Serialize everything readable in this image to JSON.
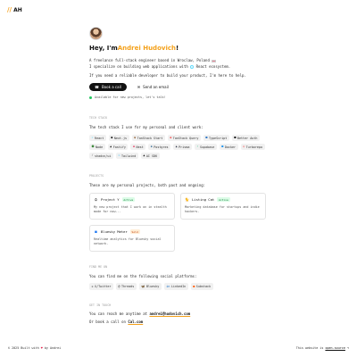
{
  "header": {
    "logo_slash": "//",
    "logo_text": "AH"
  },
  "hero": {
    "greeting_prefix": "Hey, I'm ",
    "name": "Andrei Hudovich",
    "greeting_suffix": "!",
    "line1": "A freelance full-stack engineer based in Wroclaw, Poland",
    "line2a": "I specialize on building web applications with",
    "line2b": "React",
    "line2c": "ecosystem.",
    "line3": "If you need a reliable developer to build your product, I'm here to help.",
    "book_call": "Book a call",
    "send_email": "Send an email",
    "availability": "Available for new projects, let's talk!"
  },
  "tech_stack": {
    "label": "TECH STACK",
    "text": "The tech stack I use for my personal and client work:",
    "tags": [
      {
        "icon": "react-icon",
        "glyph": "⚛",
        "color": "#61dafb",
        "label": "React"
      },
      {
        "icon": "nextjs-icon",
        "glyph": "●",
        "color": "#111111",
        "label": "Next.js"
      },
      {
        "icon": "tanstack-start-icon",
        "glyph": "◉",
        "color": "#8b5a2b",
        "label": "TanStack Start"
      },
      {
        "icon": "tanstack-query-icon",
        "glyph": "◉",
        "color": "#ef4444",
        "label": "TanStack Query"
      },
      {
        "icon": "typescript-icon",
        "glyph": "■",
        "color": "#3178c6",
        "label": "TypeScript"
      },
      {
        "icon": "better-auth-icon",
        "glyph": "■",
        "color": "#111111",
        "label": "Better Auth"
      },
      {
        "icon": "node-icon",
        "glyph": "⬢",
        "color": "#3c873a",
        "label": "Node"
      },
      {
        "icon": "fastify-icon",
        "glyph": "▲",
        "color": "#111111",
        "label": "Fastify"
      },
      {
        "icon": "nest-icon",
        "glyph": "◆",
        "color": "#e0234e",
        "label": "Nest"
      },
      {
        "icon": "postgres-icon",
        "glyph": "◆",
        "color": "#336791",
        "label": "Postgres"
      },
      {
        "icon": "prisma-icon",
        "glyph": "▲",
        "color": "#2d3748",
        "label": "Prisma"
      },
      {
        "icon": "supabase-icon",
        "glyph": "⚡",
        "color": "#3ecf8e",
        "label": "Supabase"
      },
      {
        "icon": "docker-icon",
        "glyph": "■",
        "color": "#2496ed",
        "label": "Docker"
      },
      {
        "icon": "turborepo-icon",
        "glyph": "◎",
        "color": "#ef4444",
        "label": "Turborepo"
      },
      {
        "icon": "shadcn-icon",
        "glyph": "⁄",
        "color": "#111111",
        "label": "shadcn/ui"
      },
      {
        "icon": "tailwind-icon",
        "glyph": "≈",
        "color": "#38bdf8",
        "label": "Tailwind"
      },
      {
        "icon": "ai-sdk-icon",
        "glyph": "▲",
        "color": "#111111",
        "label": "AI SDK"
      }
    ]
  },
  "projects": {
    "label": "PROJECTS",
    "text": "These are my personal projects, both past and ongoing:",
    "items": [
      {
        "icon": "project-y-icon",
        "glyph": "⛭",
        "color": "#111111",
        "title": "Project Y",
        "badge": "Active",
        "badge_kind": "active",
        "desc": "My new project that I work on in stealth mode for now..."
      },
      {
        "icon": "listing-cat-icon",
        "glyph": "🐈",
        "color": "#111111",
        "title": "Listing Cat",
        "badge": "Active",
        "badge_kind": "active",
        "desc": "Marketing database for startups and indie hackers."
      },
      {
        "icon": "bluesky-meter-icon",
        "glyph": "■",
        "color": "#1d77f2",
        "title": "Bluesky Meter",
        "badge": "Sold",
        "badge_kind": "sold",
        "desc": "Realtime analytics for Bluesky social network."
      }
    ]
  },
  "find_me": {
    "label": "FIND ME ON",
    "text": "You can find me on the following social platforms:",
    "items": [
      {
        "icon": "x-twitter-icon",
        "glyph": "✕",
        "color": "#111111",
        "label": "X/Twitter"
      },
      {
        "icon": "threads-icon",
        "glyph": "@",
        "color": "#111111",
        "label": "Threads"
      },
      {
        "icon": "bluesky-icon",
        "glyph": "🦋",
        "color": "#1d77f2",
        "label": "Bluesky"
      },
      {
        "icon": "linkedin-icon",
        "glyph": "in",
        "color": "#0a66c2",
        "label": "LinkedIn"
      },
      {
        "icon": "substack-icon",
        "glyph": "■",
        "color": "#ff6719",
        "label": "Substack"
      }
    ]
  },
  "contact": {
    "label": "GET IN TOUCH",
    "line1_prefix": "You can reach me anytime at ",
    "email": "andrei@hudovich.com",
    "line2_prefix": "Or book a call on ",
    "cal": "Cal.com"
  },
  "footer": {
    "left_prefix": "© 2025 Built with",
    "left_suffix": "by Andrei",
    "right_prefix": "This website is",
    "right_link": "open-source"
  }
}
